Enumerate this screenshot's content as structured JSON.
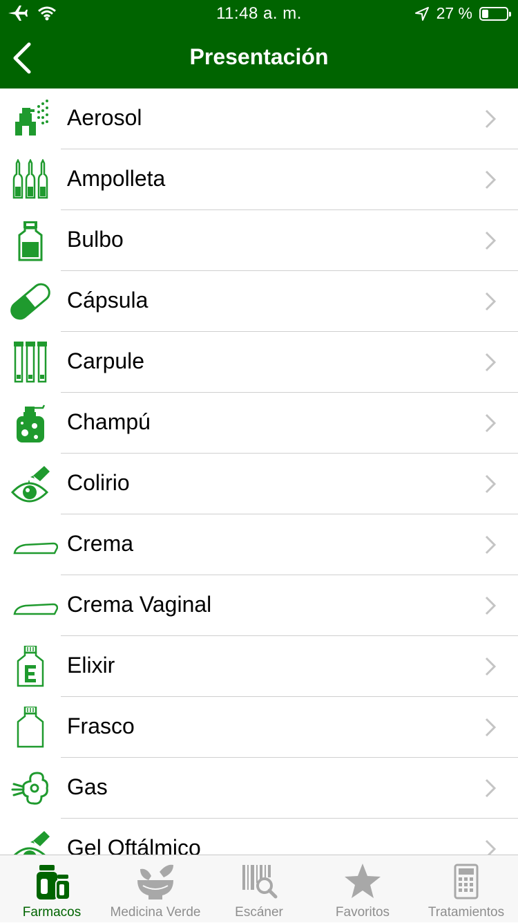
{
  "status_bar": {
    "time": "11:48 a. m.",
    "battery": "27 %",
    "battery_level": 0.27
  },
  "nav": {
    "title": "Presentación"
  },
  "colors": {
    "brand_green": "#006400",
    "icon_green": "#1f9a2e",
    "inactive_gray": "#8e8e8e"
  },
  "list": {
    "items": [
      {
        "label": "Aerosol",
        "icon": "aerosol-icon"
      },
      {
        "label": "Ampolleta",
        "icon": "ampoule-icon"
      },
      {
        "label": "Bulbo",
        "icon": "vial-icon"
      },
      {
        "label": "Cápsula",
        "icon": "capsule-icon"
      },
      {
        "label": "Carpule",
        "icon": "carpule-icon"
      },
      {
        "label": "Champú",
        "icon": "shampoo-icon"
      },
      {
        "label": "Colirio",
        "icon": "eye-drops-icon"
      },
      {
        "label": "Crema",
        "icon": "cream-icon"
      },
      {
        "label": "Crema Vaginal",
        "icon": "cream-icon"
      },
      {
        "label": "Elixir",
        "icon": "elixir-icon"
      },
      {
        "label": "Frasco",
        "icon": "bottle-icon"
      },
      {
        "label": "Gas",
        "icon": "gas-icon"
      },
      {
        "label": "Gel Oftálmico",
        "icon": "eye-gel-icon"
      }
    ]
  },
  "tabs": [
    {
      "label": "Farmacos",
      "icon": "pill-bottles-icon",
      "active": true
    },
    {
      "label": "Medicina Verde",
      "icon": "mortar-leaf-icon",
      "active": false
    },
    {
      "label": "Escáner",
      "icon": "barcode-scan-icon",
      "active": false
    },
    {
      "label": "Favoritos",
      "icon": "star-icon",
      "active": false
    },
    {
      "label": "Tratamientos",
      "icon": "calculator-icon",
      "active": false
    }
  ]
}
